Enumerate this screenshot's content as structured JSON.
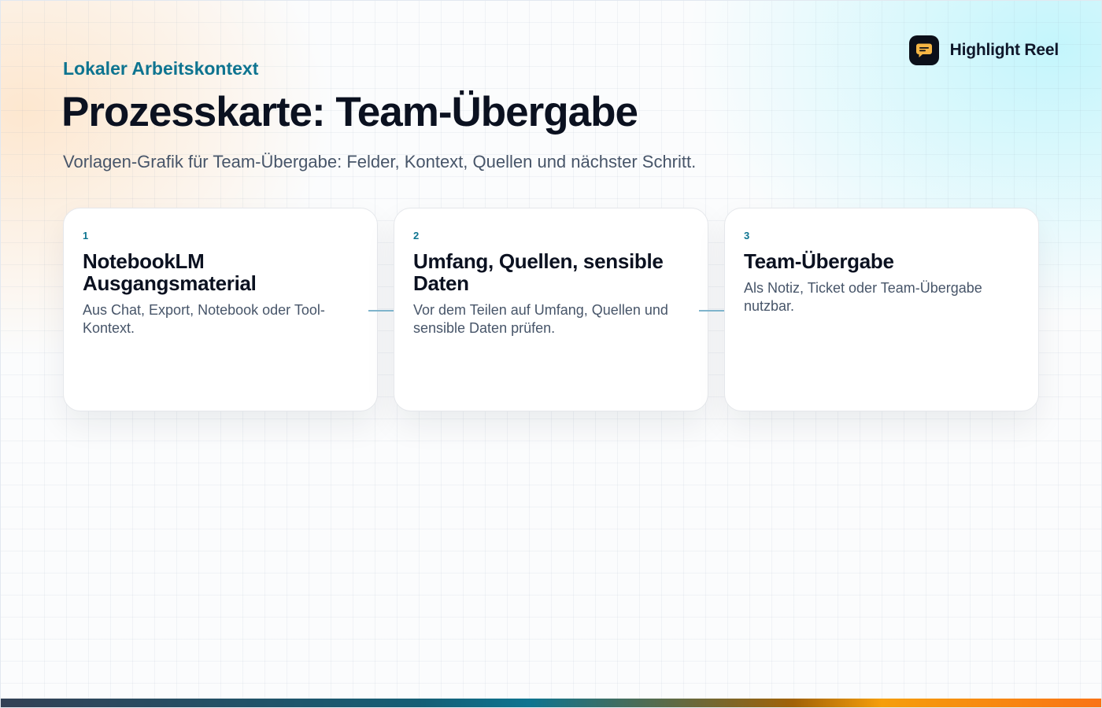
{
  "brand": {
    "name": "Highlight Reel",
    "icon": "chat-bubble-icon",
    "icon_bg": "#0b0f19",
    "icon_accent": "#f5b544"
  },
  "header": {
    "eyebrow": "Lokaler Arbeitskontext",
    "title": "Prozesskarte: Team-Übergabe",
    "subtitle": "Vorlagen-Grafik für Team-Übergabe: Felder, Kontext, Quellen und nächster Schritt."
  },
  "steps": [
    {
      "number": "1",
      "title": "NotebookLM Ausgangsmaterial",
      "description": "Aus Chat, Export, Notebook oder Tool-Kontext."
    },
    {
      "number": "2",
      "title": "Umfang, Quellen, sensible Daten",
      "description": "Vor dem Teilen auf Umfang, Quellen und sensible Daten prüfen."
    },
    {
      "number": "3",
      "title": "Team-Übergabe",
      "description": "Als Notiz, Ticket oder Team-Übergabe nutzbar."
    }
  ],
  "colors": {
    "accent": "#0e7490",
    "title": "#0b1120",
    "muted": "#475569",
    "connector": "#7fb4cc"
  }
}
